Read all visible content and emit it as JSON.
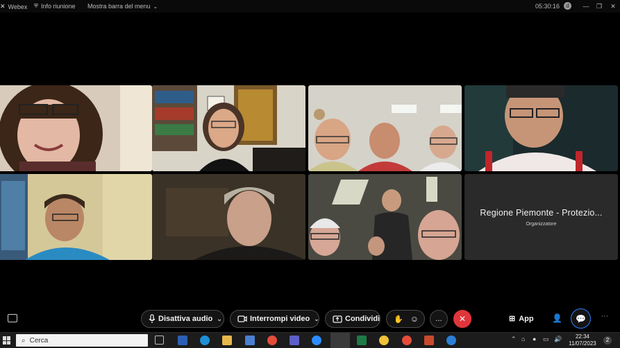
{
  "topbar": {
    "app_name": "Webex",
    "meeting_info": "Info riunione",
    "show_menu": "Mostra barra del menu",
    "time": "05:30:16",
    "avatar_initial": "d"
  },
  "organizer_tile": {
    "name": "Regione Piemonte - Protezio...",
    "role": "Organizzatore"
  },
  "controls": {
    "mute_label": "Disattiva audio",
    "video_label": "Interrompi video",
    "share_label": "Condividi",
    "more_label": "...",
    "apps_label": "App"
  },
  "taskbar": {
    "search_placeholder": "Cerca",
    "clock_time": "22:34",
    "clock_date": "11/07/2023",
    "notification_count": "2"
  },
  "colors": {
    "end_call": "#e0353b",
    "accent": "#2d7cf6"
  }
}
